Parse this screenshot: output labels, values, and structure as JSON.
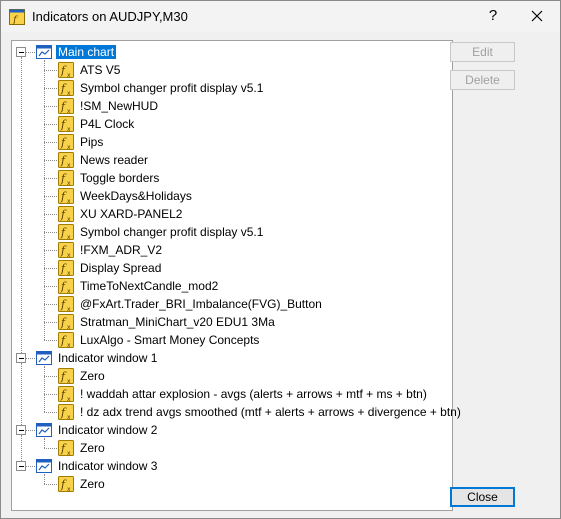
{
  "window": {
    "title": "Indicators on AUDJPY,M30",
    "help_label": "?",
    "close_glyph": "close-icon"
  },
  "buttons": {
    "edit": "Edit",
    "delete": "Delete",
    "close": "Close"
  },
  "tree": {
    "groups": [
      {
        "label": "Main chart",
        "selected": true,
        "items": [
          "ATS V5",
          "Symbol changer profit display v5.1",
          "!SM_NewHUD",
          "P4L Clock",
          "Pips",
          "News reader",
          "Toggle borders",
          "WeekDays&Holidays",
          "XU XARD-PANEL2",
          "Symbol changer profit display v5.1",
          "!FXM_ADR_V2",
          "Display Spread",
          "TimeToNextCandle_mod2",
          "@FxArt.Trader_BRI_Imbalance(FVG)_Button",
          "Stratman_MiniChart_v20 EDU1 3Ma",
          "LuxAlgo - Smart Money Concepts"
        ]
      },
      {
        "label": "Indicator window 1",
        "selected": false,
        "items": [
          "Zero",
          "! waddah attar explosion - avgs (alerts + arrows + mtf + ms + btn)",
          "! dz adx trend avgs smoothed (mtf + alerts + arrows + divergence + btn)"
        ]
      },
      {
        "label": "Indicator window 2",
        "selected": false,
        "items": [
          "Zero"
        ]
      },
      {
        "label": "Indicator window 3",
        "selected": false,
        "items": [
          "Zero"
        ]
      }
    ]
  },
  "colors": {
    "selection": "#0078d7",
    "icon_yellow": "#f7d24a",
    "icon_blue": "#1f5fbf"
  }
}
